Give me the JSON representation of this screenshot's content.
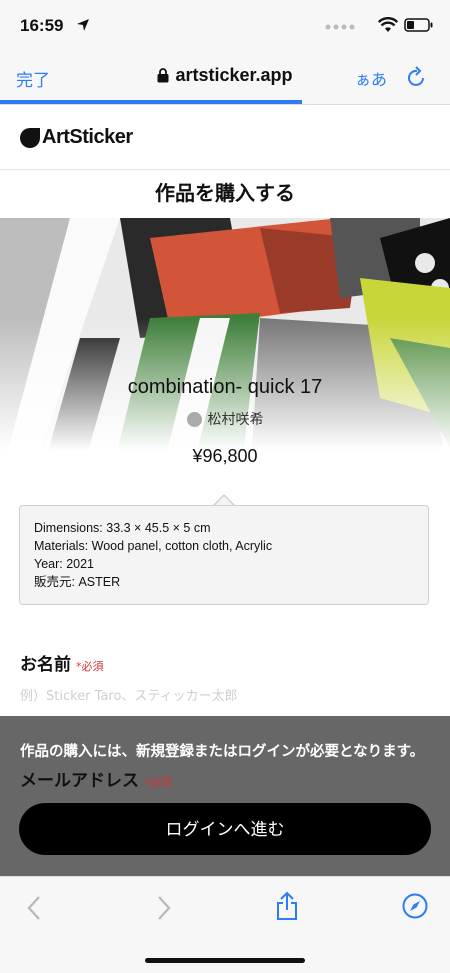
{
  "status": {
    "time": "16:59"
  },
  "browser": {
    "done_label": "完了",
    "url": "artsticker.app",
    "text_size_label": "ぁあ",
    "load_progress": 0.67
  },
  "site": {
    "logo_text": "ArtSticker"
  },
  "page": {
    "title": "作品を購入する"
  },
  "artwork": {
    "title": "combination- quick 17",
    "artist": "松村咲希",
    "price": "¥96,800",
    "details": [
      "Dimensions: 33.3 × 45.5 × 5 cm",
      "Materials: Wood panel, cotton cloth, Acrylic",
      "Year: 2021",
      "販売元: ASTER"
    ]
  },
  "form": {
    "name_label": "お名前",
    "required": "*必須",
    "name_placeholder": "例）Sticker Taro、スティッカー太郎",
    "email_label": "メールアドレス"
  },
  "overlay": {
    "message": "作品の購入には、新規登録またはログインが必要となります。",
    "login_button": "ログインへ進む"
  },
  "toolbar": {
    "icons": [
      "back-icon",
      "forward-icon",
      "share-icon",
      "compass-icon"
    ]
  },
  "colors": {
    "accent": "#2d7cf6",
    "required": "#d83232",
    "button": "#000000"
  }
}
